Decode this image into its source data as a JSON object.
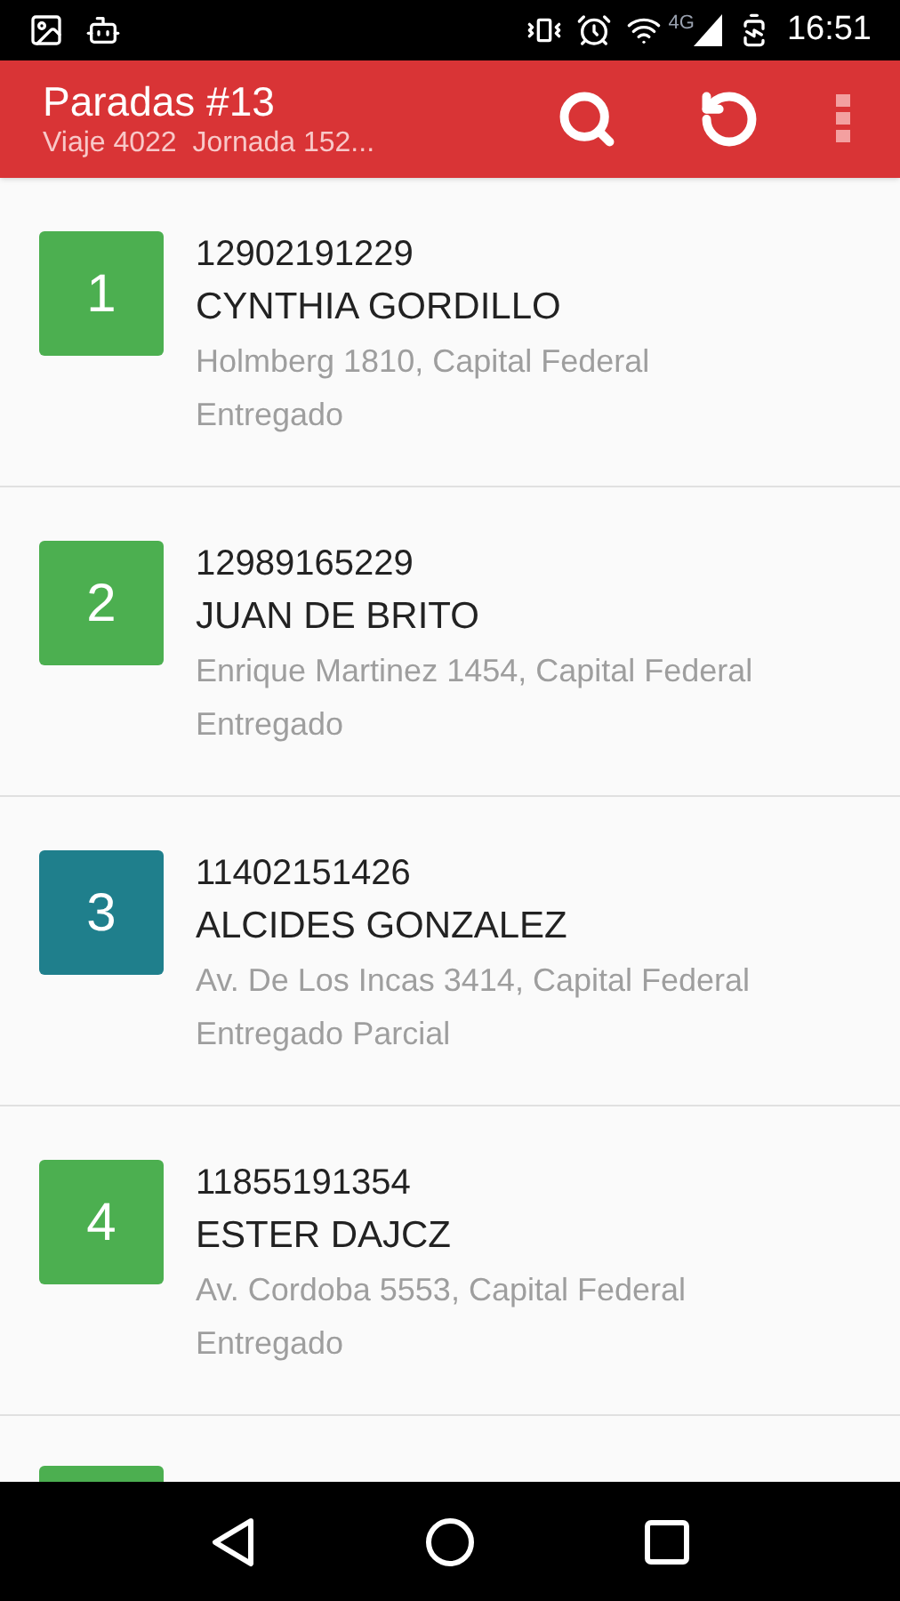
{
  "status_bar": {
    "time": "16:51",
    "network": "4G"
  },
  "app_bar": {
    "title": "Paradas #13",
    "subtitle": "Viaje 4022  Jornada 152..."
  },
  "stops": [
    {
      "index": "1",
      "code": "12902191229",
      "name": "CYNTHIA GORDILLO",
      "address": "Holmberg 1810, Capital Federal",
      "status": "Entregado",
      "color": "#4caf50"
    },
    {
      "index": "2",
      "code": "12989165229",
      "name": "JUAN DE BRITO",
      "address": "Enrique Martinez 1454, Capital Federal",
      "status": "Entregado",
      "color": "#4caf50"
    },
    {
      "index": "3",
      "code": "11402151426",
      "name": "ALCIDES GONZALEZ",
      "address": "Av. De Los Incas 3414, Capital Federal",
      "status": "Entregado Parcial",
      "color": "#1f7f8c"
    },
    {
      "index": "4",
      "code": "11855191354",
      "name": "ESTER DAJCZ",
      "address": "Av. Cordoba 5553, Capital Federal",
      "status": "Entregado",
      "color": "#4caf50"
    }
  ],
  "next_stop_peek": {
    "color": "#4caf50"
  }
}
